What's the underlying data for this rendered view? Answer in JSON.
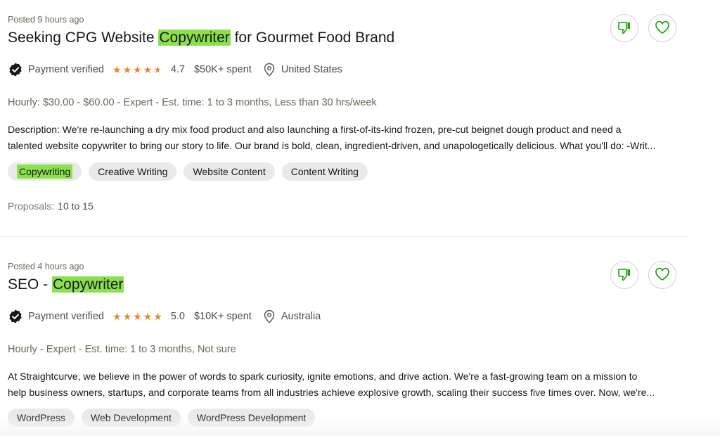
{
  "jobs": [
    {
      "posted": "Posted 9 hours ago",
      "title_pre": "Seeking CPG Website ",
      "title_hl": "Copywriter",
      "title_post": " for Gourmet Food Brand",
      "payment": "Payment verified",
      "rating": "4.7",
      "stars": 4.7,
      "spent": "$50K+ spent",
      "location": "United States",
      "terms": "Hourly: $30.00 - $60.00 - Expert - Est. time: 1 to 3 months, Less than 30 hrs/week",
      "desc_line1": "Description: We're re-launching a dry mix food product and also launching a first-of-its-kind frozen, pre-cut beignet dough product and need a",
      "desc_line2": "talented website copywriter to bring our story to life. Our brand is bold, clean, ingredient-driven, and unapologetically delicious. What you'll do: -Writ...",
      "tags": [
        "Copywriting",
        "Creative Writing",
        "Website Content",
        "Content Writing"
      ],
      "proposals_label": "Proposals:",
      "proposals_value": "10 to 15"
    },
    {
      "posted": "Posted 4 hours ago",
      "title_pre": "SEO - ",
      "title_hl": "Copywriter",
      "title_post": "",
      "payment": "Payment verified",
      "rating": "5.0",
      "stars": 5.0,
      "spent": "$10K+ spent",
      "location": "Australia",
      "terms": "Hourly - Expert - Est. time: 1 to 3 months, Not sure",
      "desc_line1": "At Straightcurve, we believe in the power of words to spark curiosity, ignite emotions, and drive action. We're a fast-growing team on a mission to",
      "desc_line2": "help business owners, startups, and corporate teams from all industries achieve explosive growth, scaling their success five times over. Now, we're...",
      "tags": [
        "WordPress",
        "Web Development",
        "WordPress Development"
      ]
    }
  ],
  "colors": {
    "highlight": "#8be04e",
    "star": "#e08a2e",
    "accent_green": "#14a800"
  },
  "icons": [
    "verified-badge-icon",
    "star-icon",
    "location-pin-icon",
    "thumbs-down-icon",
    "heart-icon"
  ]
}
